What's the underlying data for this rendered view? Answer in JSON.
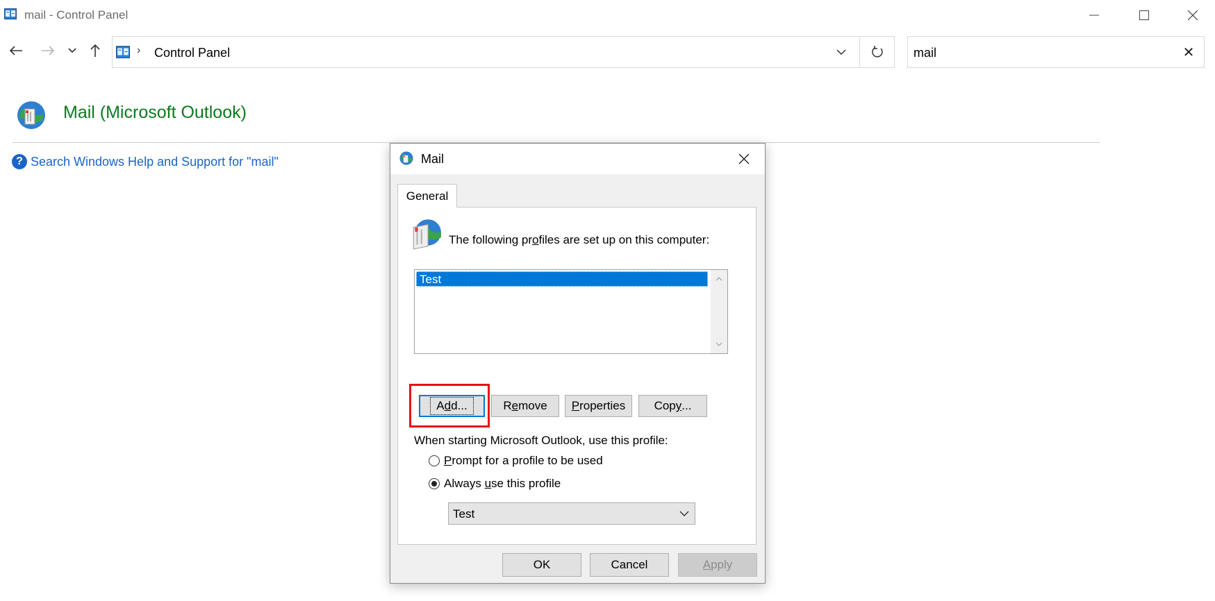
{
  "window": {
    "title": "mail - Control Panel",
    "controls": [
      "minimize",
      "maximize",
      "close"
    ]
  },
  "nav": {
    "back_icon": "back-arrow-icon",
    "forward_icon": "forward-arrow-icon",
    "recent_icon": "chevron-down-icon",
    "up_icon": "up-arrow-icon",
    "breadcrumb_separator": "›",
    "breadcrumb": "Control Panel",
    "search_value": "mail",
    "search_clear": "✕"
  },
  "content": {
    "result_title": "Mail (Microsoft Outlook)",
    "help_icon_text": "?",
    "help_link": "Search Windows Help and Support for \"mail\""
  },
  "dialog": {
    "title": "Mail",
    "tab": "General",
    "profiles_label_pre": "The following profiles are set up on this computer:",
    "profiles_label_parts": [
      "The following pr",
      "o",
      "files are set up on this computer:"
    ],
    "profiles": [
      "Test"
    ],
    "buttons": {
      "add_parts": [
        "A",
        "d",
        "d..."
      ],
      "remove_parts": [
        "R",
        "e",
        "move"
      ],
      "properties_parts": [
        "",
        "P",
        "roperties"
      ],
      "copy_parts": [
        "Cop",
        "y",
        "..."
      ]
    },
    "startup_label": "When starting Microsoft Outlook, use this profile:",
    "radio_prompt_parts": [
      "",
      "P",
      "rompt for a profile to be used"
    ],
    "radio_always_parts": [
      "Always ",
      "u",
      "se this profile"
    ],
    "radio_selected": "always",
    "default_profile": "Test",
    "footer": {
      "ok": "OK",
      "cancel": "Cancel",
      "apply_parts": [
        "",
        "A",
        "pply"
      ]
    }
  },
  "colors": {
    "link_green": "#0b7a1e",
    "link_blue": "#1a64c8",
    "selection": "#0078d7",
    "highlight_red": "#e8101a"
  }
}
